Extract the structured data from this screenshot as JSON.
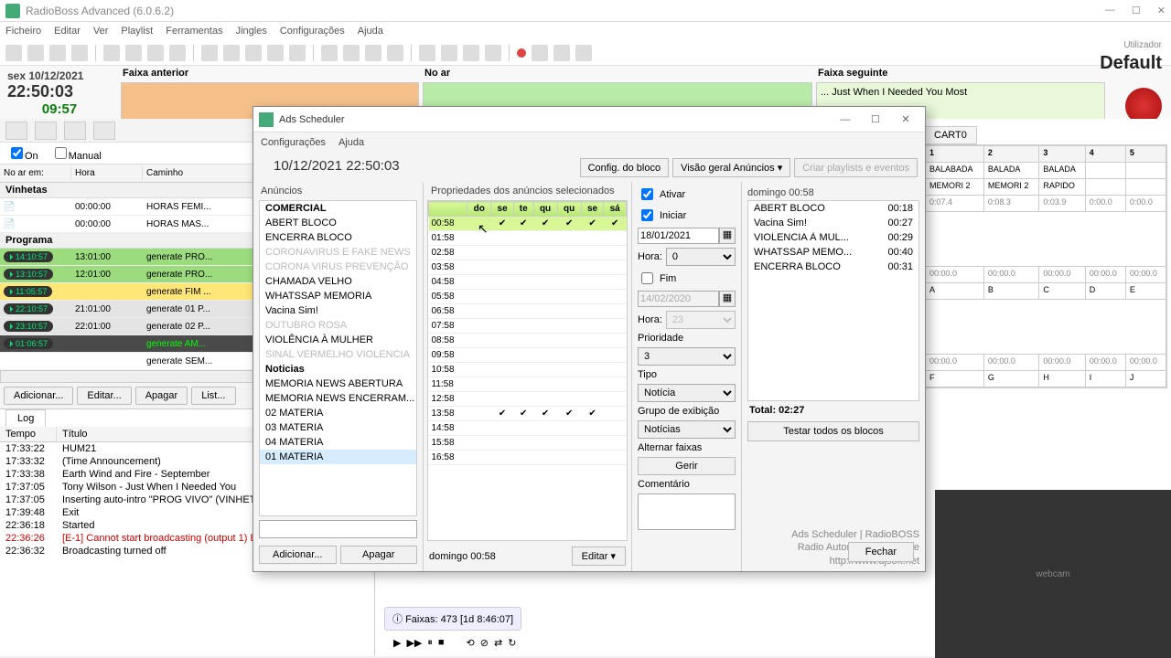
{
  "app": {
    "title": "RadioBoss Advanced (6.0.6.2)",
    "user_label": "Utilizador",
    "profile": "Default"
  },
  "menu": [
    "Ficheiro",
    "Editar",
    "Ver",
    "Playlist",
    "Ferramentas",
    "Jingles",
    "Configurações",
    "Ajuda"
  ],
  "clock": {
    "date": "sex 10/12/2021",
    "time": "22:50:03",
    "countdown": "09:57"
  },
  "panels": {
    "prev": "Faixa anterior",
    "now": "No ar",
    "next": "Faixa seguinte",
    "next_track": "... Just When I Needed You Most"
  },
  "onrow": {
    "on": "On",
    "manual": "Manual"
  },
  "grid_headers": {
    "noarem": "No ar em:",
    "hora": "Hora",
    "caminho": "Caminho"
  },
  "sections": {
    "vinhetas": "Vinhetas",
    "programa": "Programa"
  },
  "vinhetas": [
    {
      "t": "",
      "h": "00:00:00",
      "p": "HORAS FEMI..."
    },
    {
      "t": "",
      "h": "00:00:00",
      "p": "HORAS MAS..."
    }
  ],
  "programa": [
    {
      "badge": "14:10:57",
      "h": "13:01:00",
      "p": "generate PRO...",
      "cls": "g-green"
    },
    {
      "badge": "13:10:57",
      "h": "12:01:00",
      "p": "generate PRO...",
      "cls": "g-green"
    },
    {
      "badge": "11:05:57",
      "h": "",
      "p": "generate FIM ...",
      "cls": "g-yellow"
    },
    {
      "badge": "22:10:57",
      "h": "21:01:00",
      "p": "generate 01 P...",
      "cls": "g-gray"
    },
    {
      "badge": "23:10:57",
      "h": "22:01:00",
      "p": "generate 02 P...",
      "cls": "g-gray"
    },
    {
      "badge": "01:06:57",
      "h": "",
      "p": "generate AM...",
      "cls": "g-dark"
    },
    {
      "badge": "",
      "h": "",
      "p": "generate SEM...",
      "cls": ""
    }
  ],
  "listbtns": {
    "add": "Adicionar...",
    "edit": "Editar...",
    "del": "Apagar",
    "list": "List..."
  },
  "log": {
    "tab": "Log",
    "headers": {
      "tempo": "Tempo",
      "titulo": "Título"
    },
    "rows": [
      {
        "t": "17:33:22",
        "m": "HUM21"
      },
      {
        "t": "17:33:32",
        "m": "(Time Announcement)"
      },
      {
        "t": "17:33:38",
        "m": "Earth Wind and Fire - September"
      },
      {
        "t": "17:37:05",
        "m": "Tony Wilson - Just When I Needed You"
      },
      {
        "t": "17:37:05",
        "m": "Inserting auto-intro \"PROG VIVO\" (VINHETA MPB ROCK...."
      },
      {
        "t": "17:39:48",
        "m": "Exit"
      },
      {
        "t": "22:36:18",
        "m": "Started"
      },
      {
        "t": "22:36:26",
        "m": "[E-1] Cannot start broadcasting (output 1) Error -1 (No de...",
        "err": true
      },
      {
        "t": "22:36:32",
        "m": "Broadcasting turned off"
      }
    ]
  },
  "player": {
    "tracks": "Faixas: 473 [1d 8:46:07]"
  },
  "cart": {
    "tab": "CART0",
    "cols": [
      "1",
      "2",
      "3",
      "4",
      "5"
    ],
    "rows": [
      [
        "BALABADA",
        "BALADA",
        "BALADA",
        "",
        ""
      ],
      [
        "MEMORI 2",
        "MEMORI 2",
        "RAPIDO",
        "",
        ""
      ]
    ],
    "letters_rows": [
      [
        "A",
        "B",
        "C",
        "D",
        "E"
      ],
      [
        "F",
        "G",
        "H",
        "I",
        "J"
      ]
    ],
    "times1": [
      "0:07.4",
      "0:08.3",
      "0:03.9",
      "0:00.0",
      "0:00.0"
    ],
    "zeros": [
      "00:00.0",
      "00:00.0",
      "00:00.0",
      "00:00.0",
      "00:00.0"
    ]
  },
  "dialog": {
    "title": "Ads Scheduler",
    "menu": [
      "Configurações",
      "Ajuda"
    ],
    "datetime": "10/12/2021 22:50:03",
    "topbtns": {
      "config": "Config. do bloco",
      "overview": "Visão geral Anúncios",
      "create": "Criar playlists e eventos"
    },
    "col1": {
      "hdr": "Anúncios",
      "items": [
        {
          "t": "COMERCIAL",
          "cls": "bold"
        },
        {
          "t": "ABERT BLOCO"
        },
        {
          "t": "ENCERRA BLOCO"
        },
        {
          "t": "CORONAVIRUS E FAKE NEWS",
          "cls": "dim"
        },
        {
          "t": "CORONA VIRUS PREVENÇÃO",
          "cls": "dim"
        },
        {
          "t": "CHAMADA VELHO"
        },
        {
          "t": "WHATSSAP MEMORIA"
        },
        {
          "t": "Vacina Sim!"
        },
        {
          "t": "OUTUBRO ROSA",
          "cls": "dim"
        },
        {
          "t": "VIOLÊNCIA À MULHER"
        },
        {
          "t": "SINAL VERMELHO VIOLENCIA",
          "cls": "dim"
        },
        {
          "t": "Noticias",
          "cls": "bold"
        },
        {
          "t": "MEMORIA NEWS ABERTURA"
        },
        {
          "t": "MEMORIA NEWS ENCERRAM..."
        },
        {
          "t": "02 MATERIA"
        },
        {
          "t": "03 MATERIA"
        },
        {
          "t": "04 MATERIA"
        },
        {
          "t": "01 MATERIA",
          "cls": "sel"
        }
      ],
      "add": "Adicionar...",
      "del": "Apagar"
    },
    "col2": {
      "hdr": "Propriedades dos anúncios selecionados",
      "days": [
        "do",
        "se",
        "te",
        "qu",
        "qu",
        "se",
        "sá"
      ],
      "times": [
        "00:58",
        "01:58",
        "02:58",
        "03:58",
        "04:58",
        "05:58",
        "06:58",
        "07:58",
        "08:58",
        "09:58",
        "10:58",
        "11:58",
        "12:58",
        "13:58",
        "14:58",
        "15:58",
        "16:58"
      ],
      "checked_row": 0,
      "checked_row2": 13,
      "footer_label": "domingo 00:58",
      "edit": "Editar"
    },
    "col3": {
      "ativar": "Ativar",
      "iniciar": "Iniciar",
      "fim": "Fim",
      "date1": "18/01/2021",
      "hora_lbl": "Hora:",
      "hora1": "0",
      "date2": "14/02/2020",
      "hora2": "23",
      "prio_lbl": "Prioridade",
      "prio": "3",
      "tipo_lbl": "Tipo",
      "tipo": "Notícia",
      "grupo_lbl": "Grupo de exibição",
      "grupo": "Notícias",
      "alt_lbl": "Alternar faixas",
      "gerir": "Gerir",
      "com_lbl": "Comentário"
    },
    "col4": {
      "hdr": "domingo 00:58",
      "rows": [
        {
          "n": "ABERT BLOCO",
          "d": "00:18"
        },
        {
          "n": "Vacina Sim!",
          "d": "00:27"
        },
        {
          "n": "VIOLENCIA À MUL...",
          "d": "00:29"
        },
        {
          "n": "WHATSSAP MEMO...",
          "d": "00:40"
        },
        {
          "n": "ENCERRA BLOCO",
          "d": "00:31"
        }
      ],
      "total": "Total: 02:27",
      "test": "Testar todos os blocos",
      "credit1": "Ads Scheduler | RadioBOSS",
      "credit2": "Radio Automation Software",
      "credit3": "http://www.djsoft.net"
    },
    "close": "Fechar"
  }
}
